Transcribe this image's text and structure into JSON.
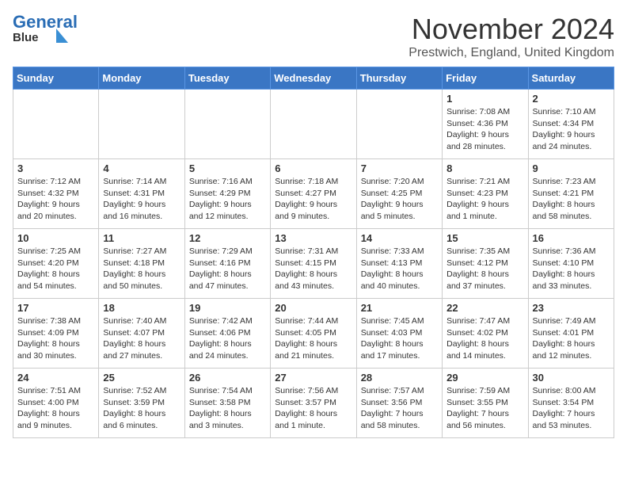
{
  "logo": {
    "line1": "General",
    "line2": "Blue"
  },
  "title": "November 2024",
  "location": "Prestwich, England, United Kingdom",
  "days_header": [
    "Sunday",
    "Monday",
    "Tuesday",
    "Wednesday",
    "Thursday",
    "Friday",
    "Saturday"
  ],
  "weeks": [
    [
      {
        "num": "",
        "info": ""
      },
      {
        "num": "",
        "info": ""
      },
      {
        "num": "",
        "info": ""
      },
      {
        "num": "",
        "info": ""
      },
      {
        "num": "",
        "info": ""
      },
      {
        "num": "1",
        "info": "Sunrise: 7:08 AM\nSunset: 4:36 PM\nDaylight: 9 hours\nand 28 minutes."
      },
      {
        "num": "2",
        "info": "Sunrise: 7:10 AM\nSunset: 4:34 PM\nDaylight: 9 hours\nand 24 minutes."
      }
    ],
    [
      {
        "num": "3",
        "info": "Sunrise: 7:12 AM\nSunset: 4:32 PM\nDaylight: 9 hours\nand 20 minutes."
      },
      {
        "num": "4",
        "info": "Sunrise: 7:14 AM\nSunset: 4:31 PM\nDaylight: 9 hours\nand 16 minutes."
      },
      {
        "num": "5",
        "info": "Sunrise: 7:16 AM\nSunset: 4:29 PM\nDaylight: 9 hours\nand 12 minutes."
      },
      {
        "num": "6",
        "info": "Sunrise: 7:18 AM\nSunset: 4:27 PM\nDaylight: 9 hours\nand 9 minutes."
      },
      {
        "num": "7",
        "info": "Sunrise: 7:20 AM\nSunset: 4:25 PM\nDaylight: 9 hours\nand 5 minutes."
      },
      {
        "num": "8",
        "info": "Sunrise: 7:21 AM\nSunset: 4:23 PM\nDaylight: 9 hours\nand 1 minute."
      },
      {
        "num": "9",
        "info": "Sunrise: 7:23 AM\nSunset: 4:21 PM\nDaylight: 8 hours\nand 58 minutes."
      }
    ],
    [
      {
        "num": "10",
        "info": "Sunrise: 7:25 AM\nSunset: 4:20 PM\nDaylight: 8 hours\nand 54 minutes."
      },
      {
        "num": "11",
        "info": "Sunrise: 7:27 AM\nSunset: 4:18 PM\nDaylight: 8 hours\nand 50 minutes."
      },
      {
        "num": "12",
        "info": "Sunrise: 7:29 AM\nSunset: 4:16 PM\nDaylight: 8 hours\nand 47 minutes."
      },
      {
        "num": "13",
        "info": "Sunrise: 7:31 AM\nSunset: 4:15 PM\nDaylight: 8 hours\nand 43 minutes."
      },
      {
        "num": "14",
        "info": "Sunrise: 7:33 AM\nSunset: 4:13 PM\nDaylight: 8 hours\nand 40 minutes."
      },
      {
        "num": "15",
        "info": "Sunrise: 7:35 AM\nSunset: 4:12 PM\nDaylight: 8 hours\nand 37 minutes."
      },
      {
        "num": "16",
        "info": "Sunrise: 7:36 AM\nSunset: 4:10 PM\nDaylight: 8 hours\nand 33 minutes."
      }
    ],
    [
      {
        "num": "17",
        "info": "Sunrise: 7:38 AM\nSunset: 4:09 PM\nDaylight: 8 hours\nand 30 minutes."
      },
      {
        "num": "18",
        "info": "Sunrise: 7:40 AM\nSunset: 4:07 PM\nDaylight: 8 hours\nand 27 minutes."
      },
      {
        "num": "19",
        "info": "Sunrise: 7:42 AM\nSunset: 4:06 PM\nDaylight: 8 hours\nand 24 minutes."
      },
      {
        "num": "20",
        "info": "Sunrise: 7:44 AM\nSunset: 4:05 PM\nDaylight: 8 hours\nand 21 minutes."
      },
      {
        "num": "21",
        "info": "Sunrise: 7:45 AM\nSunset: 4:03 PM\nDaylight: 8 hours\nand 17 minutes."
      },
      {
        "num": "22",
        "info": "Sunrise: 7:47 AM\nSunset: 4:02 PM\nDaylight: 8 hours\nand 14 minutes."
      },
      {
        "num": "23",
        "info": "Sunrise: 7:49 AM\nSunset: 4:01 PM\nDaylight: 8 hours\nand 12 minutes."
      }
    ],
    [
      {
        "num": "24",
        "info": "Sunrise: 7:51 AM\nSunset: 4:00 PM\nDaylight: 8 hours\nand 9 minutes."
      },
      {
        "num": "25",
        "info": "Sunrise: 7:52 AM\nSunset: 3:59 PM\nDaylight: 8 hours\nand 6 minutes."
      },
      {
        "num": "26",
        "info": "Sunrise: 7:54 AM\nSunset: 3:58 PM\nDaylight: 8 hours\nand 3 minutes."
      },
      {
        "num": "27",
        "info": "Sunrise: 7:56 AM\nSunset: 3:57 PM\nDaylight: 8 hours\nand 1 minute."
      },
      {
        "num": "28",
        "info": "Sunrise: 7:57 AM\nSunset: 3:56 PM\nDaylight: 7 hours\nand 58 minutes."
      },
      {
        "num": "29",
        "info": "Sunrise: 7:59 AM\nSunset: 3:55 PM\nDaylight: 7 hours\nand 56 minutes."
      },
      {
        "num": "30",
        "info": "Sunrise: 8:00 AM\nSunset: 3:54 PM\nDaylight: 7 hours\nand 53 minutes."
      }
    ]
  ]
}
